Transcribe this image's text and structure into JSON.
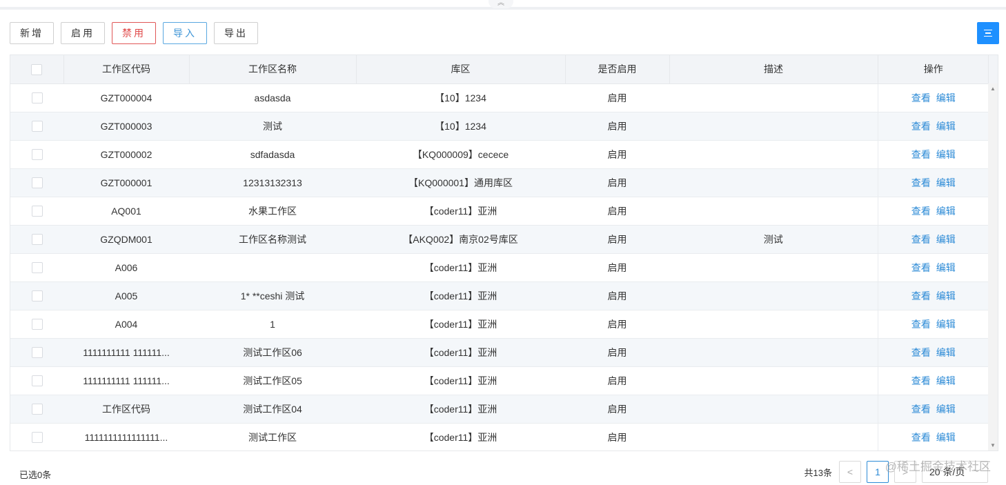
{
  "toolbar": {
    "add_label": "新增",
    "enable_label": "启用",
    "disable_label": "禁用",
    "import_label": "导入",
    "export_label": "导出"
  },
  "table": {
    "headers": {
      "code": "工作区代码",
      "name": "工作区名称",
      "area": "库区",
      "enabled": "是否启用",
      "desc": "描述",
      "action": "操作"
    },
    "action_view": "查看",
    "action_edit": "编辑",
    "rows": [
      {
        "code": "GZT000004",
        "name": "asdasda",
        "area": "【10】1234",
        "enabled": "启用",
        "desc": ""
      },
      {
        "code": "GZT000003",
        "name": "测试",
        "area": "【10】1234",
        "enabled": "启用",
        "desc": ""
      },
      {
        "code": "GZT000002",
        "name": "sdfadasda",
        "area": "【KQ000009】cecece",
        "enabled": "启用",
        "desc": ""
      },
      {
        "code": "GZT000001",
        "name": "12313132313",
        "area": "【KQ000001】通用库区",
        "enabled": "启用",
        "desc": ""
      },
      {
        "code": "AQ001",
        "name": "水果工作区",
        "area": "【coder11】亚洲",
        "enabled": "启用",
        "desc": ""
      },
      {
        "code": "GZQDM001",
        "name": "工作区名称测试",
        "area": "【AKQ002】南京02号库区",
        "enabled": "启用",
        "desc": "测试"
      },
      {
        "code": "A006",
        "name": "",
        "area": "【coder11】亚洲",
        "enabled": "启用",
        "desc": ""
      },
      {
        "code": "A005",
        "name": "1* **ceshi 测试",
        "area": "【coder11】亚洲",
        "enabled": "启用",
        "desc": ""
      },
      {
        "code": "A004",
        "name": "1",
        "area": "【coder11】亚洲",
        "enabled": "启用",
        "desc": ""
      },
      {
        "code": "1111111111 111111...",
        "name": "测试工作区06",
        "area": "【coder11】亚洲",
        "enabled": "启用",
        "desc": ""
      },
      {
        "code": "1111111111 111111...",
        "name": "测试工作区05",
        "area": "【coder11】亚洲",
        "enabled": "启用",
        "desc": ""
      },
      {
        "code": "工作区代码",
        "name": "测试工作区04",
        "area": "【coder11】亚洲",
        "enabled": "启用",
        "desc": ""
      },
      {
        "code": "1111111111111111...",
        "name": "测试工作区",
        "area": "【coder11】亚洲",
        "enabled": "启用",
        "desc": ""
      }
    ]
  },
  "footer": {
    "selected": "已选0条",
    "total": "共13条",
    "prev": "<",
    "current_page": "1",
    "next": ">",
    "page_size": "20 条/页"
  },
  "watermark": "@稀土掘金技术社区",
  "icons": {
    "collapse": "chevron-double-up-icon",
    "columns": "column-settings-icon",
    "dropdown": "chevron-down-icon"
  },
  "colors": {
    "primary": "#2b8ad6",
    "danger": "#e04848",
    "header_bg": "#f2f4f7",
    "stripe_bg": "#f4f7fa"
  }
}
